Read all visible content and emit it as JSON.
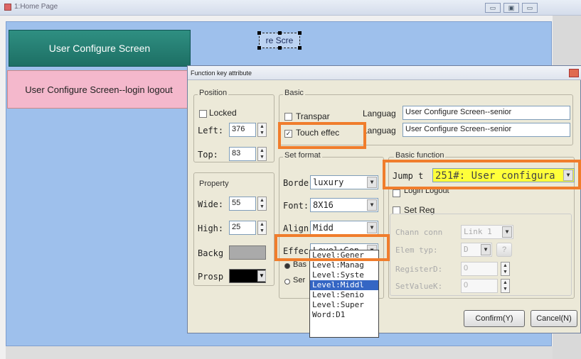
{
  "window": {
    "title": "1:Home Page",
    "buttons": [
      "▭",
      "▣",
      "▭"
    ]
  },
  "canvas": {
    "teal_button": "User Configure Screen",
    "pink_button": "User Configure Screen--login logout",
    "selected_text": "re Scre"
  },
  "dialog": {
    "title": "Function key attribute",
    "position": {
      "group_label": "Position",
      "locked_label": "Locked",
      "left_label": "Left:",
      "left_value": "376",
      "top_label": "Top:",
      "top_value": "83"
    },
    "property": {
      "group_label": "Property",
      "wide_label": "Wide:",
      "wide_value": "55",
      "high_label": "High:",
      "high_value": "25",
      "back_label": "Backg",
      "prosp_label": "Prosp"
    },
    "basic": {
      "group_label": "Basic",
      "transparent_label": "Transpar",
      "touch_label": "Touch effec",
      "language_label_1": "Languag",
      "language_value_1": "User Configure Screen--senior",
      "language_label_2": "Languag",
      "language_value_2": "User Configure Screen--senior"
    },
    "set_format": {
      "group_label": "Set format",
      "border_label": "Borde",
      "border_value": "luxury",
      "font_label": "Font:",
      "font_value": "8X16",
      "align_label": "Align",
      "align_value": "Midd",
      "effect_label": "Effec",
      "effect_value": "Level:Gen",
      "radio1_label": "Bas",
      "radio2_label": "Ser"
    },
    "basic_function": {
      "group_label": "Basic function",
      "jump_label": "Jump t",
      "jump_value": "251#: User configura",
      "login_label": "Login Logout",
      "setreg_label": "Set Reg",
      "chann_label": "Chann conn",
      "chann_value": "Link 1",
      "elem_label": "Elem typ:",
      "elem_value": "D",
      "elem_btn": "?",
      "regd_label": "RegisterD:",
      "regd_value": "0",
      "setval_label": "SetValueK:",
      "setval_value": "0"
    },
    "dropdown_items": [
      "Level:Gener",
      "Level:Manag",
      "Level:Syste",
      "Level:Middl",
      "Level:Senio",
      "Level:Super",
      "Word:D1"
    ],
    "dropdown_selected": 3,
    "confirm_label": "Confirm(Y)",
    "cancel_label": "Cancel(N)"
  },
  "colors": {
    "highlight": "#f07d2c",
    "canvas_bg": "#9ec0ec",
    "teal": "#1d6f64",
    "pink": "#f4b8cc"
  }
}
